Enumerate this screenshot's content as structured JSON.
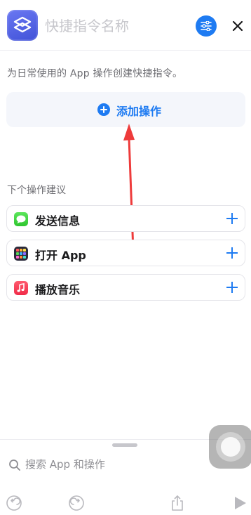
{
  "header": {
    "title_placeholder": "快捷指令名称",
    "app_icon": "shortcuts-icon",
    "settings_icon": "sliders-icon",
    "close_icon": "close-icon"
  },
  "description": "为日常使用的 App 操作创建快捷指令。",
  "add_action": {
    "label": "添加操作",
    "icon": "plus-circle-icon"
  },
  "suggestions": {
    "title": "下个操作建议",
    "items": [
      {
        "label": "发送信息",
        "icon": "messages-icon"
      },
      {
        "label": "打开 App",
        "icon": "open-app-icon"
      },
      {
        "label": "播放音乐",
        "icon": "music-icon"
      }
    ]
  },
  "search": {
    "placeholder": "搜索 App 和操作"
  },
  "toolbar": {
    "undo_icon": "undo-icon",
    "redo_icon": "redo-icon",
    "share_icon": "share-icon",
    "play_icon": "play-icon"
  },
  "colors": {
    "accent": "#1e7bf2",
    "annotation_arrow": "#ee3b3b"
  }
}
